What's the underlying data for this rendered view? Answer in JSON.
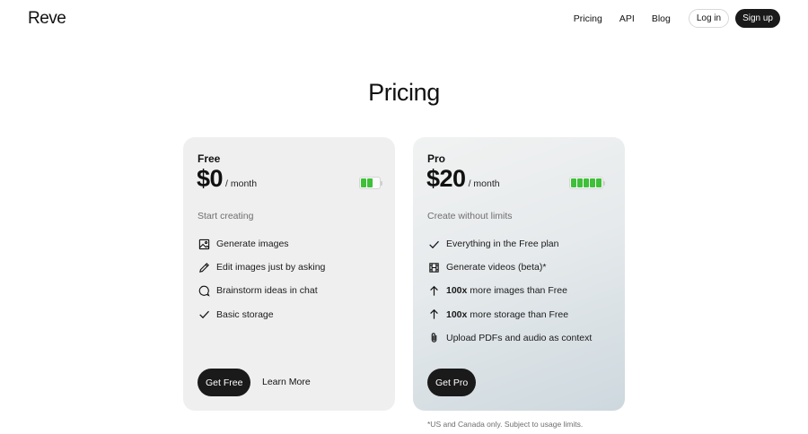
{
  "header": {
    "logo": "Reve",
    "nav": [
      "Pricing",
      "API",
      "Blog"
    ],
    "login_label": "Log in",
    "signup_label": "Sign up"
  },
  "page_title": "Pricing",
  "plans": [
    {
      "name": "Free",
      "price": "$0",
      "period": "/ month",
      "battery_level": 0.4,
      "subheading": "Start creating",
      "features": [
        {
          "icon": "image-icon",
          "text": "Generate images"
        },
        {
          "icon": "pencil-icon",
          "text": "Edit images just by asking"
        },
        {
          "icon": "chat-bubble-icon",
          "text": "Brainstorm ideas in chat"
        },
        {
          "icon": "check-icon",
          "text": "Basic storage"
        }
      ],
      "cta_label": "Get Free",
      "secondary_label": "Learn More"
    },
    {
      "name": "Pro",
      "price": "$20",
      "period": "/ month",
      "battery_level": 1.0,
      "subheading": "Create without limits",
      "features": [
        {
          "icon": "check-icon",
          "text": "Everything in the Free plan"
        },
        {
          "icon": "film-icon",
          "text": "Generate videos (beta)*"
        },
        {
          "icon": "arrow-up-icon",
          "bold": "100x",
          "text": "more images than Free"
        },
        {
          "icon": "arrow-up-icon",
          "bold": "100x",
          "text": "more storage than Free"
        },
        {
          "icon": "paperclip-icon",
          "text": "Upload PDFs and audio as context"
        }
      ],
      "cta_label": "Get Pro"
    }
  ],
  "footnote": "*US and Canada only. Subject to usage limits.",
  "colors": {
    "battery_fill": "#3fbf3a",
    "button_dark": "#1a1a1a"
  }
}
